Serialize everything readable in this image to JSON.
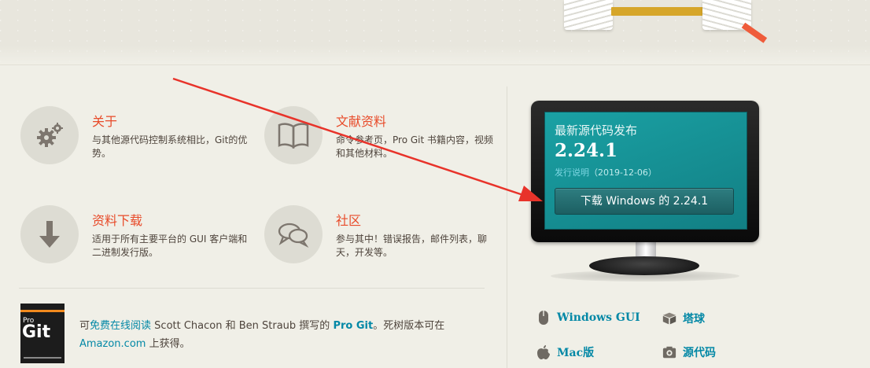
{
  "features": [
    {
      "title": "关于",
      "desc": "与其他源代码控制系统相比，Git的优势。",
      "icon": "gear-icon"
    },
    {
      "title": "文献资料",
      "desc": "命令参考页，Pro Git 书籍内容，视频和其他材料。",
      "icon": "book-icon"
    },
    {
      "title": "资料下载",
      "desc": "适用于所有主要平台的 GUI 客户端和二进制发行版。",
      "icon": "download-arrow-icon"
    },
    {
      "title": "社区",
      "desc": "参与其中！错误报告，邮件列表，聊天，开发等。",
      "icon": "chat-bubbles-icon"
    }
  ],
  "book": {
    "prefix": "可",
    "read_link": "免费在线阅读",
    "middle": " Scott Chacon 和 Ben Straub 撰写的 ",
    "title": "Pro Git",
    "suffix": "。死树版本可在",
    "amazon_link": "Amazon.com",
    "end": " 上获得。",
    "cover_pro": "Pro",
    "cover_git": "Git"
  },
  "release": {
    "title": "最新源代码发布",
    "version": "2.24.1",
    "notes_link": "发行说明",
    "date": "（2019-12-06）",
    "download_button": "下载 Windows 的 2.24.1"
  },
  "downloads": [
    {
      "label": "Windows GUI",
      "icon": "mouse-icon"
    },
    {
      "label": "塔球",
      "icon": "package-icon"
    },
    {
      "label": "Mac版",
      "icon": "apple-icon"
    },
    {
      "label": "源代码",
      "icon": "source-code-icon"
    }
  ],
  "colors": {
    "accent": "#e84b2a",
    "link": "#0388a6",
    "screen": "#148e92",
    "background": "#f0efe7"
  }
}
